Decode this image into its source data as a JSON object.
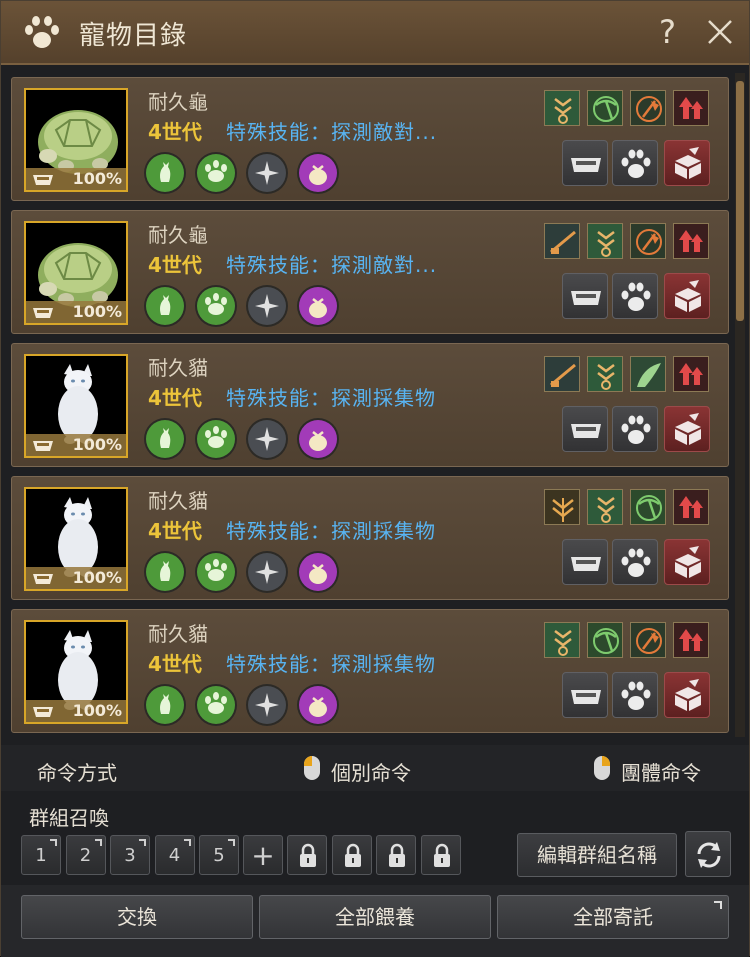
{
  "window": {
    "title": "寵物目錄",
    "help": "?"
  },
  "pets": [
    {
      "name": "耐久龜",
      "generation": "4世代",
      "skill": "特殊技能：探測敵對...",
      "hunger": "100%",
      "species": "turtle",
      "skills": [
        "gather-icon",
        "pickaxe-icon",
        "axe-icon",
        "arrow-up-icon"
      ]
    },
    {
      "name": "耐久龜",
      "generation": "4世代",
      "skill": "特殊技能：探測敵對...",
      "hunger": "100%",
      "species": "turtle",
      "skills": [
        "rifle-icon",
        "gather-icon",
        "axe-icon",
        "arrow-up-icon"
      ]
    },
    {
      "name": "耐久貓",
      "generation": "4世代",
      "skill": "特殊技能：探測採集物",
      "hunger": "100%",
      "species": "cat",
      "skills": [
        "rifle-icon",
        "gather-icon",
        "wing-icon",
        "arrow-up-icon"
      ]
    },
    {
      "name": "耐久貓",
      "generation": "4世代",
      "skill": "特殊技能：探測採集物",
      "hunger": "100%",
      "species": "cat",
      "skills": [
        "grain-icon",
        "gather-icon",
        "pickaxe-icon",
        "arrow-up-icon"
      ]
    },
    {
      "name": "耐久貓",
      "generation": "4世代",
      "skill": "特殊技能：探測採集物",
      "hunger": "100%",
      "species": "cat",
      "skills": [
        "gather-icon",
        "pickaxe-icon",
        "axe-icon",
        "arrow-up-icon"
      ]
    }
  ],
  "command": {
    "label": "命令方式",
    "individual": "個別命令",
    "group": "團體命令"
  },
  "group_summon": {
    "label": "群組召喚",
    "slots": [
      "1",
      "2",
      "3",
      "4",
      "5"
    ],
    "add": "+",
    "edit_name": "編輯群組名稱"
  },
  "footer": {
    "exchange": "交換",
    "feed_all": "全部餵養",
    "store_all": "全部寄託"
  },
  "colors": {
    "generation": "#ecc43a",
    "skill_text": "#58b4f2",
    "portrait_border": "#d8a628",
    "title_bar": "#6b5338"
  }
}
